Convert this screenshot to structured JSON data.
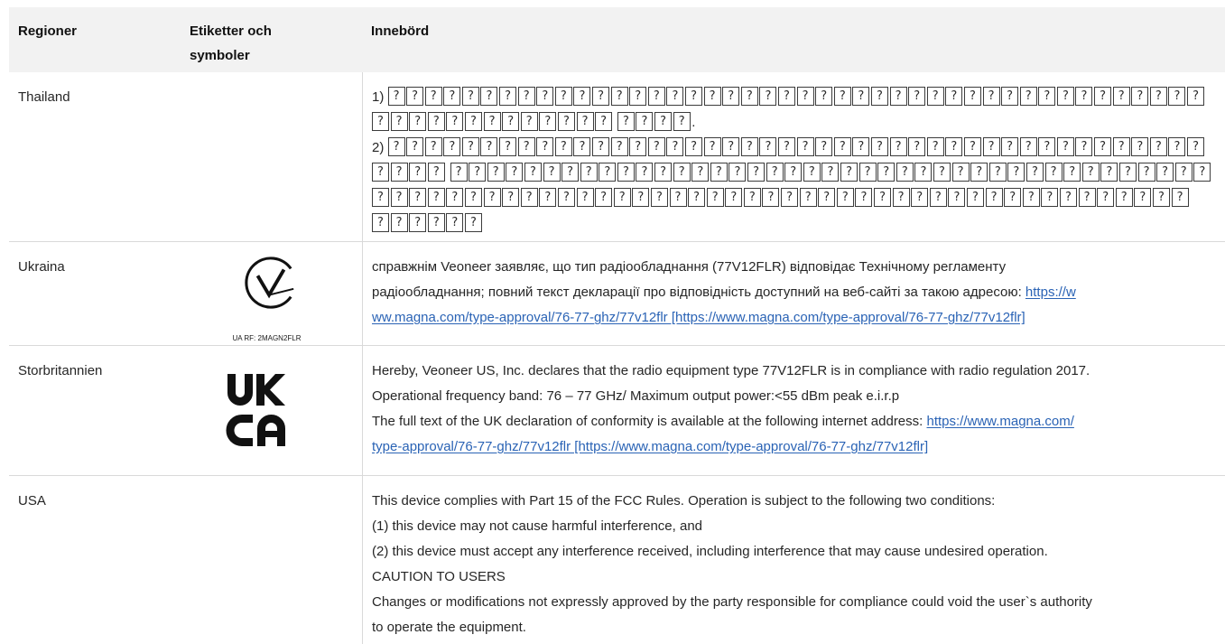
{
  "colors": {
    "header_bg": "#f2f2f2",
    "border": "#d9d9d9",
    "text": "#262626",
    "link": "#2a63b5"
  },
  "table": {
    "headers": {
      "region": "Regioner",
      "labels": "Etiketter och symboler",
      "meaning": "Innebörd"
    },
    "rows": [
      {
        "region": "Thailand",
        "lines": [
          {
            "text": "1) ⍰⍰⍰⍰⍰⍰⍰⍰⍰⍰⍰⍰⍰⍰⍰⍰⍰⍰⍰⍰⍰⍰⍰⍰⍰⍰⍰⍰⍰⍰⍰⍰⍰⍰⍰⍰⍰⍰⍰⍰⍰⍰⍰⍰"
          },
          {
            "text": "⍰⍰⍰⍰⍰⍰⍰⍰⍰⍰⍰⍰⍰ ⍰⍰⍰⍰."
          },
          {
            "text": "2) ⍰⍰⍰⍰⍰⍰⍰⍰⍰⍰⍰⍰⍰⍰⍰⍰⍰⍰⍰⍰⍰⍰⍰⍰⍰⍰⍰⍰⍰⍰⍰⍰⍰⍰⍰⍰⍰⍰⍰⍰⍰⍰⍰⍰"
          },
          {
            "text": "⍰⍰⍰⍰ ⍰⍰⍰⍰⍰⍰⍰⍰⍰⍰⍰⍰⍰⍰⍰⍰⍰⍰⍰⍰⍰⍰⍰⍰⍰⍰⍰⍰⍰⍰⍰⍰⍰⍰⍰⍰⍰⍰⍰⍰⍰"
          },
          {
            "text": "⍰⍰⍰⍰⍰⍰⍰⍰⍰⍰⍰⍰⍰⍰⍰⍰⍰⍰⍰⍰⍰⍰⍰⍰⍰⍰⍰⍰⍰⍰⍰⍰⍰⍰⍰⍰⍰⍰⍰⍰⍰⍰⍰⍰"
          },
          {
            "text": "⍰⍰⍰⍰⍰⍰"
          }
        ]
      },
      {
        "region": "Ukraina",
        "label": {
          "icon": "ukraine-conformity-mark",
          "caption": "UA RF: 2MAGN2FLR"
        },
        "lines": [
          {
            "text": "справжнім Veoneer заявляє, що тип радіообладнання (77V12FLR) відповідає Технічному регламенту"
          },
          {
            "text": "радіообладнання; повний текст декларації про відповідність доступний на веб-сайті за такою адресою: ",
            "link": "https://w"
          },
          {
            "link": "ww.magna.com/type-approval/76-77-ghz/77v12flr [https://www.magna.com/type-approval/76-77-ghz/77v12flr]"
          }
        ]
      },
      {
        "region": "Storbritannien",
        "label": {
          "icon": "ukca-mark",
          "logo_text": [
            "UK",
            "CA"
          ]
        },
        "lines": [
          {
            "text": "Hereby, Veoneer US, Inc. declares that the radio equipment type 77V12FLR is in compliance with radio regulation 2017."
          },
          {
            "text": "Operational frequency band: 76 – 77 GHz/ Maximum output power:<55 dBm peak e.i.r.p"
          },
          {
            "text": "The full text of the UK declaration of conformity is available at the following internet address: ",
            "link": "https://www.magna.com/"
          },
          {
            "link": "type-approval/76-77-ghz/77v12flr [https://www.magna.com/type-approval/76-77-ghz/77v12flr]"
          }
        ]
      },
      {
        "region": "USA",
        "lines": [
          {
            "text": "This device complies with Part 15 of the FCC Rules. Operation is subject to the following two conditions:"
          },
          {
            "text": "(1) this device may not cause harmful interference, and"
          },
          {
            "text": "(2) this device must accept any interference received, including interference that may cause undesired operation."
          },
          {
            "text": "CAUTION TO USERS"
          },
          {
            "text": "Changes or modifications not expressly approved by the party responsible for compliance could void the user`s authority"
          },
          {
            "text": "to operate the equipment."
          }
        ]
      }
    ]
  }
}
